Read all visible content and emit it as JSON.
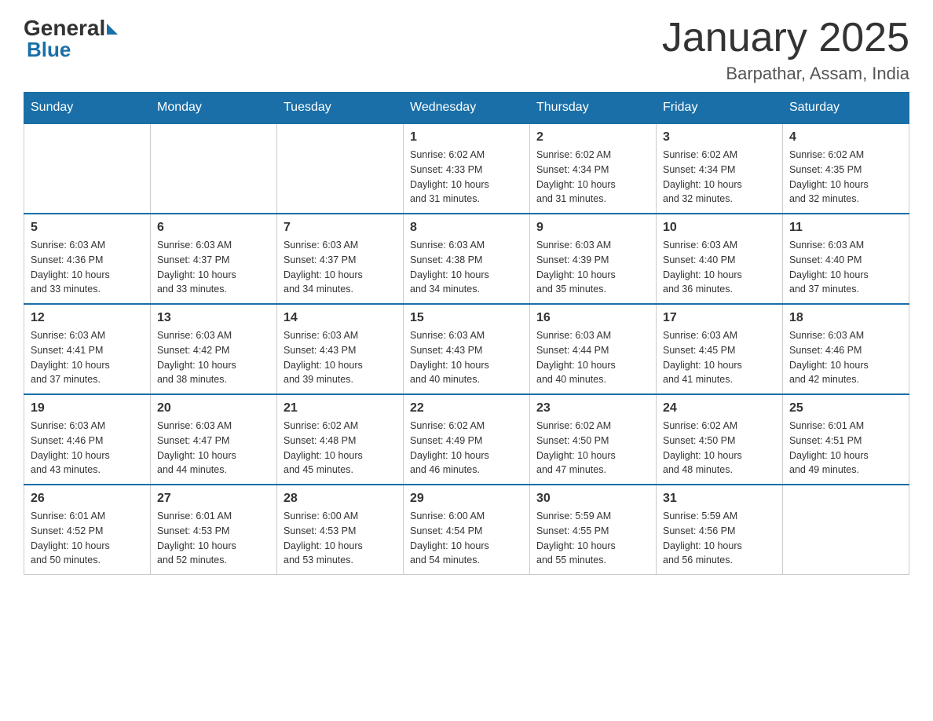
{
  "logo": {
    "text_general": "General",
    "text_blue": "Blue"
  },
  "title": "January 2025",
  "location": "Barpathar, Assam, India",
  "days_of_week": [
    "Sunday",
    "Monday",
    "Tuesday",
    "Wednesday",
    "Thursday",
    "Friday",
    "Saturday"
  ],
  "weeks": [
    [
      {
        "day": "",
        "info": ""
      },
      {
        "day": "",
        "info": ""
      },
      {
        "day": "",
        "info": ""
      },
      {
        "day": "1",
        "info": "Sunrise: 6:02 AM\nSunset: 4:33 PM\nDaylight: 10 hours\nand 31 minutes."
      },
      {
        "day": "2",
        "info": "Sunrise: 6:02 AM\nSunset: 4:34 PM\nDaylight: 10 hours\nand 31 minutes."
      },
      {
        "day": "3",
        "info": "Sunrise: 6:02 AM\nSunset: 4:34 PM\nDaylight: 10 hours\nand 32 minutes."
      },
      {
        "day": "4",
        "info": "Sunrise: 6:02 AM\nSunset: 4:35 PM\nDaylight: 10 hours\nand 32 minutes."
      }
    ],
    [
      {
        "day": "5",
        "info": "Sunrise: 6:03 AM\nSunset: 4:36 PM\nDaylight: 10 hours\nand 33 minutes."
      },
      {
        "day": "6",
        "info": "Sunrise: 6:03 AM\nSunset: 4:37 PM\nDaylight: 10 hours\nand 33 minutes."
      },
      {
        "day": "7",
        "info": "Sunrise: 6:03 AM\nSunset: 4:37 PM\nDaylight: 10 hours\nand 34 minutes."
      },
      {
        "day": "8",
        "info": "Sunrise: 6:03 AM\nSunset: 4:38 PM\nDaylight: 10 hours\nand 34 minutes."
      },
      {
        "day": "9",
        "info": "Sunrise: 6:03 AM\nSunset: 4:39 PM\nDaylight: 10 hours\nand 35 minutes."
      },
      {
        "day": "10",
        "info": "Sunrise: 6:03 AM\nSunset: 4:40 PM\nDaylight: 10 hours\nand 36 minutes."
      },
      {
        "day": "11",
        "info": "Sunrise: 6:03 AM\nSunset: 4:40 PM\nDaylight: 10 hours\nand 37 minutes."
      }
    ],
    [
      {
        "day": "12",
        "info": "Sunrise: 6:03 AM\nSunset: 4:41 PM\nDaylight: 10 hours\nand 37 minutes."
      },
      {
        "day": "13",
        "info": "Sunrise: 6:03 AM\nSunset: 4:42 PM\nDaylight: 10 hours\nand 38 minutes."
      },
      {
        "day": "14",
        "info": "Sunrise: 6:03 AM\nSunset: 4:43 PM\nDaylight: 10 hours\nand 39 minutes."
      },
      {
        "day": "15",
        "info": "Sunrise: 6:03 AM\nSunset: 4:43 PM\nDaylight: 10 hours\nand 40 minutes."
      },
      {
        "day": "16",
        "info": "Sunrise: 6:03 AM\nSunset: 4:44 PM\nDaylight: 10 hours\nand 40 minutes."
      },
      {
        "day": "17",
        "info": "Sunrise: 6:03 AM\nSunset: 4:45 PM\nDaylight: 10 hours\nand 41 minutes."
      },
      {
        "day": "18",
        "info": "Sunrise: 6:03 AM\nSunset: 4:46 PM\nDaylight: 10 hours\nand 42 minutes."
      }
    ],
    [
      {
        "day": "19",
        "info": "Sunrise: 6:03 AM\nSunset: 4:46 PM\nDaylight: 10 hours\nand 43 minutes."
      },
      {
        "day": "20",
        "info": "Sunrise: 6:03 AM\nSunset: 4:47 PM\nDaylight: 10 hours\nand 44 minutes."
      },
      {
        "day": "21",
        "info": "Sunrise: 6:02 AM\nSunset: 4:48 PM\nDaylight: 10 hours\nand 45 minutes."
      },
      {
        "day": "22",
        "info": "Sunrise: 6:02 AM\nSunset: 4:49 PM\nDaylight: 10 hours\nand 46 minutes."
      },
      {
        "day": "23",
        "info": "Sunrise: 6:02 AM\nSunset: 4:50 PM\nDaylight: 10 hours\nand 47 minutes."
      },
      {
        "day": "24",
        "info": "Sunrise: 6:02 AM\nSunset: 4:50 PM\nDaylight: 10 hours\nand 48 minutes."
      },
      {
        "day": "25",
        "info": "Sunrise: 6:01 AM\nSunset: 4:51 PM\nDaylight: 10 hours\nand 49 minutes."
      }
    ],
    [
      {
        "day": "26",
        "info": "Sunrise: 6:01 AM\nSunset: 4:52 PM\nDaylight: 10 hours\nand 50 minutes."
      },
      {
        "day": "27",
        "info": "Sunrise: 6:01 AM\nSunset: 4:53 PM\nDaylight: 10 hours\nand 52 minutes."
      },
      {
        "day": "28",
        "info": "Sunrise: 6:00 AM\nSunset: 4:53 PM\nDaylight: 10 hours\nand 53 minutes."
      },
      {
        "day": "29",
        "info": "Sunrise: 6:00 AM\nSunset: 4:54 PM\nDaylight: 10 hours\nand 54 minutes."
      },
      {
        "day": "30",
        "info": "Sunrise: 5:59 AM\nSunset: 4:55 PM\nDaylight: 10 hours\nand 55 minutes."
      },
      {
        "day": "31",
        "info": "Sunrise: 5:59 AM\nSunset: 4:56 PM\nDaylight: 10 hours\nand 56 minutes."
      },
      {
        "day": "",
        "info": ""
      }
    ]
  ]
}
